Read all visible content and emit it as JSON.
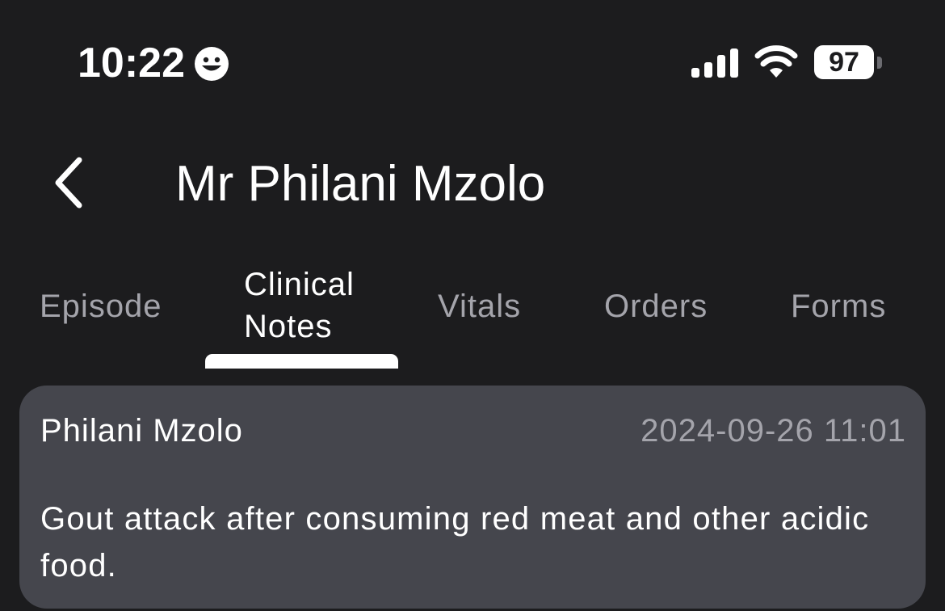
{
  "status_bar": {
    "time": "10:22",
    "battery_level": "97",
    "icons": [
      "face-icon",
      "signal-icon",
      "wifi-icon",
      "battery-icon"
    ]
  },
  "header": {
    "title": "Mr Philani Mzolo",
    "back_icon": "chevron-left-icon"
  },
  "tabs": [
    {
      "label": "Episode",
      "active": false
    },
    {
      "label": "Clinical Notes",
      "active": true
    },
    {
      "label": "Vitals",
      "active": false
    },
    {
      "label": "Orders",
      "active": false
    },
    {
      "label": "Forms",
      "active": false
    }
  ],
  "notes": [
    {
      "author": "Philani Mzolo",
      "timestamp": "2024-09-26 11:01",
      "body": "Gout attack after consuming red meat and other acidic food."
    }
  ],
  "colors": {
    "background": "#1c1c1e",
    "card": "#45464d",
    "muted_text": "#a4a4ab",
    "text": "#ffffff"
  }
}
